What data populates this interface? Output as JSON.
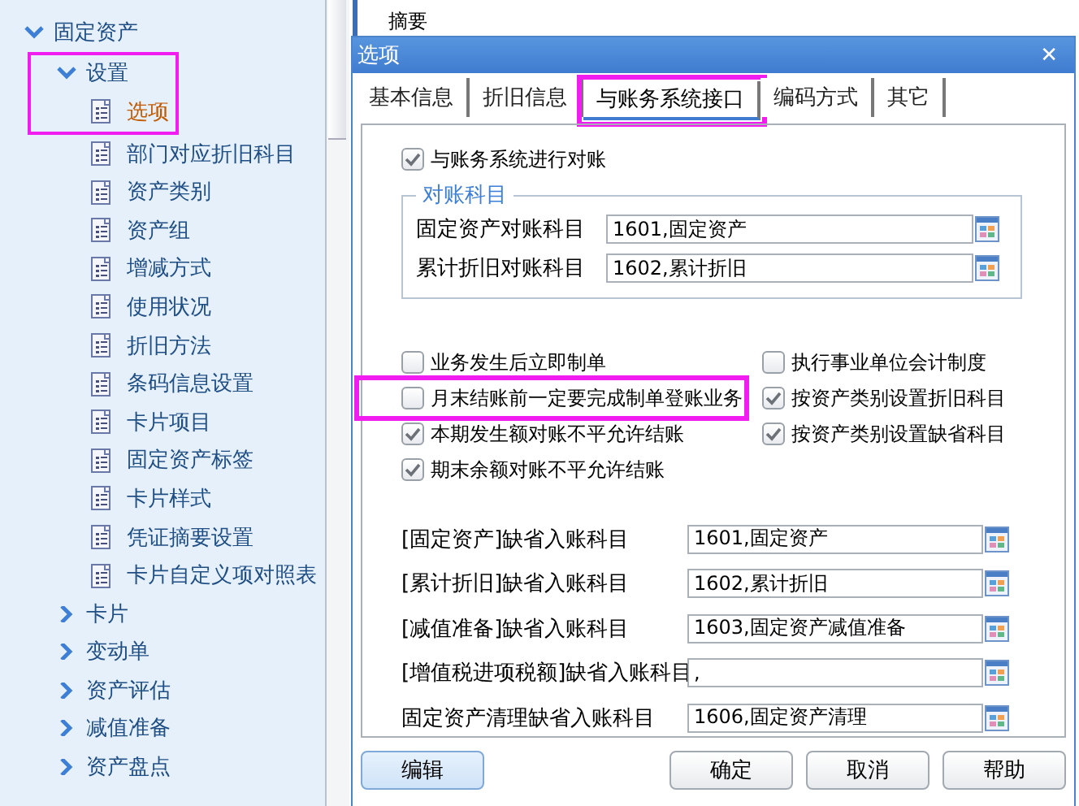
{
  "background": {
    "column_header": "摘要"
  },
  "sidebar": {
    "items": [
      {
        "label": "固定资产",
        "expanded": true,
        "children": [
          {
            "label": "设置",
            "expanded": true,
            "highlighted": true,
            "children": [
              {
                "label": "选项",
                "selected": true,
                "highlighted": true
              },
              {
                "label": "部门对应折旧科目",
                "selected": false
              },
              {
                "label": "资产类别",
                "selected": false
              },
              {
                "label": "资产组",
                "selected": false
              },
              {
                "label": "增减方式",
                "selected": false
              },
              {
                "label": "使用状况",
                "selected": false
              },
              {
                "label": "折旧方法",
                "selected": false
              },
              {
                "label": "条码信息设置",
                "selected": false
              },
              {
                "label": "卡片项目",
                "selected": false
              },
              {
                "label": "固定资产标签",
                "selected": false
              },
              {
                "label": "卡片样式",
                "selected": false
              },
              {
                "label": "凭证摘要设置",
                "selected": false
              },
              {
                "label": "卡片自定义项对照表",
                "selected": false
              }
            ]
          },
          {
            "label": "卡片",
            "expanded": false
          },
          {
            "label": "变动单",
            "expanded": false
          },
          {
            "label": "资产评估",
            "expanded": false
          },
          {
            "label": "减值准备",
            "expanded": false
          },
          {
            "label": "资产盘点",
            "expanded": false
          }
        ]
      }
    ]
  },
  "dialog": {
    "title": "选项",
    "close": "✕",
    "tabs": [
      {
        "label": "基本信息",
        "selected": false,
        "highlighted": false
      },
      {
        "label": "折旧信息",
        "selected": false,
        "highlighted": false
      },
      {
        "label": "与账务系统接口",
        "selected": true,
        "highlighted": true
      },
      {
        "label": "编码方式",
        "selected": false,
        "highlighted": false
      },
      {
        "label": "其它",
        "selected": false,
        "highlighted": false
      }
    ],
    "reconcile": {
      "label": "与账务系统进行对账",
      "checked": true
    },
    "group": {
      "legend": "对账科目",
      "rows": [
        {
          "label": "固定资产对账科目",
          "value": "1601,固定资产"
        },
        {
          "label": "累计折旧对账科目",
          "value": "1602,累计折旧"
        }
      ]
    },
    "options": [
      {
        "label": "业务发生后立即制单",
        "checked": false,
        "highlighted": false
      },
      {
        "label": "执行事业单位会计制度",
        "checked": false,
        "highlighted": false
      },
      {
        "label": "月末结账前一定要完成制单登账业务",
        "checked": false,
        "highlighted": true
      },
      {
        "label": "按资产类别设置折旧科目",
        "checked": true,
        "highlighted": false
      },
      {
        "label": "本期发生额对账不平允许结账",
        "checked": true,
        "highlighted": false
      },
      {
        "label": "按资产类别设置缺省科目",
        "checked": true,
        "highlighted": false
      },
      {
        "label": "期末余额对账不平允许结账",
        "checked": true,
        "highlighted": false
      }
    ],
    "defaults": [
      {
        "label": "[固定资产]缺省入账科目",
        "value": "1601,固定资产"
      },
      {
        "label": "[累计折旧]缺省入账科目",
        "value": "1602,累计折旧"
      },
      {
        "label": "[减值准备]缺省入账科目",
        "value": "1603,固定资产减值准备"
      },
      {
        "label": "[增值税进项税额]缺省入账科目",
        "value": ","
      },
      {
        "label": "固定资产清理缺省入账科目",
        "value": "1606,固定资产清理"
      }
    ],
    "buttons": [
      {
        "label": "编辑",
        "focused": true
      },
      {
        "label": "确定",
        "focused": false
      },
      {
        "label": "取消",
        "focused": false
      },
      {
        "label": "帮助",
        "focused": false
      }
    ]
  }
}
